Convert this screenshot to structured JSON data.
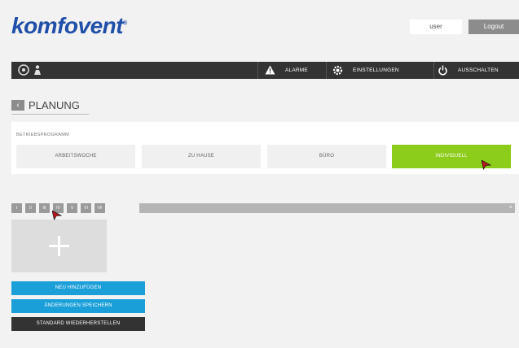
{
  "header": {
    "logo_text": "komfovent",
    "logo_mark": "®",
    "user_label": "user",
    "logout_label": "Logout"
  },
  "topbar": {
    "alarms_label": "ALARME",
    "settings_label": "EINSTELLUNGEN",
    "shutdown_label": "AUSSCHALTEN",
    "left_icons": [
      "fan-icon",
      "person-icon"
    ]
  },
  "page": {
    "back_glyph": "‹",
    "title": "PLANUNG"
  },
  "program": {
    "label": "BETRIEBSPROGRAMM",
    "options": [
      {
        "label": "ARBEITSWOCHE",
        "active": false
      },
      {
        "label": "ZU HAUSE",
        "active": false
      },
      {
        "label": "BÜRO",
        "active": false
      },
      {
        "label": "INDIVIDUELL",
        "active": true
      }
    ]
  },
  "days": {
    "tabs": [
      "I",
      "II",
      "III",
      "IV",
      "V",
      "VI",
      "VII"
    ],
    "close_glyph": "×"
  },
  "actions": {
    "add_new": "NEU HINZUFÜGEN",
    "save_changes": "ÄNDERUNGEN SPEICHERN",
    "restore_default": "STANDARD WIEDERHERSTELLEN"
  },
  "colors": {
    "brand": "#1f4fa8",
    "active_program": "#8ccc1a",
    "action_blue": "#1a9fd8",
    "dark_bar": "#333333"
  }
}
